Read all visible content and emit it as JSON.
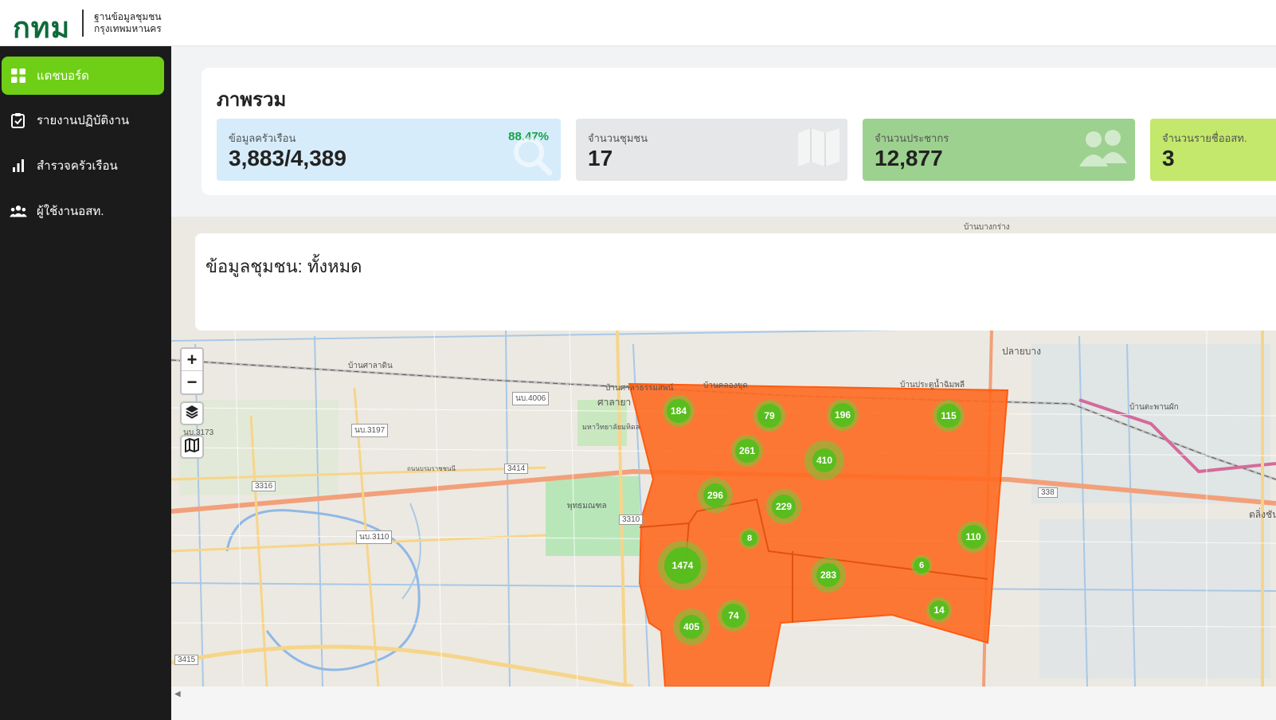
{
  "header": {
    "logo_mark": "กทม",
    "logo_line1": "ฐานข้อมูลชุมชน",
    "logo_line2": "กรุงเทพมหานคร"
  },
  "sidebar": {
    "items": [
      {
        "label": "แดชบอร์ด",
        "icon": "dashboard-icon",
        "active": true
      },
      {
        "label": "รายงานปฏิบัติงาน",
        "icon": "clipboard-icon",
        "active": false
      },
      {
        "label": "สำรวจครัวเรือน",
        "icon": "bar-chart-icon",
        "active": false
      },
      {
        "label": "ผู้ใช้งานอสท.",
        "icon": "users-icon",
        "active": false
      }
    ],
    "accent": "#6fcf17",
    "background": "#1b1b1b"
  },
  "overview": {
    "title": "ภาพรวม",
    "cards": [
      {
        "title": "ข้อมูลครัวเรือน",
        "value": "3,883/4,389",
        "percent": "88.47%",
        "color": "#d6ecfb",
        "icon": "search-icon"
      },
      {
        "title": "จำนวนชุมชน",
        "value": "17",
        "color": "#e5e7e8",
        "icon": "map-icon"
      },
      {
        "title": "จำนวนประชากร",
        "value": "12,877",
        "color": "#9dd18f",
        "icon": "people-icon"
      },
      {
        "title": "จำนวนรายชื่ออสท.",
        "value": "3",
        "color": "#c3e86b",
        "icon": "user-icon"
      }
    ]
  },
  "community_panel": {
    "title": "ข้อมูลชุมชน: ทั้งหมด"
  },
  "map": {
    "zoom_in": "+",
    "zoom_out": "−",
    "region_color": "#ff6a21",
    "clusters": [
      "184",
      "79",
      "196",
      "115",
      "261",
      "410",
      "296",
      "229",
      "8",
      "110",
      "1474",
      "283",
      "6",
      "74",
      "405",
      "14"
    ],
    "labels": {
      "l1": "บ้านศาลาดิน",
      "l2": "บ้านบางกร่าง",
      "l3": "ปลายบาง",
      "l4": "บ้านตะพานผัก",
      "l5": "ตลิ่งชัน",
      "l6": "พุทธมณฑล",
      "l7": "ศาลายา",
      "l8": "บ้านคลองขุด",
      "l9": "บ้านศาลาธรรมสพน์",
      "l10": "บ้านประตูน้ำฉิมพลี",
      "r1": "นบ.4006",
      "r2": "นบ.3197",
      "r3": "3414",
      "r4": "3316",
      "r5": "นบ.3110",
      "r6": "3310",
      "r7": "338",
      "r8": "นบ.3173",
      "r9": "3415",
      "r10": "ถนนบรมราชชนนี",
      "r11": "มหาวิทยาลัยมหิดล"
    }
  }
}
